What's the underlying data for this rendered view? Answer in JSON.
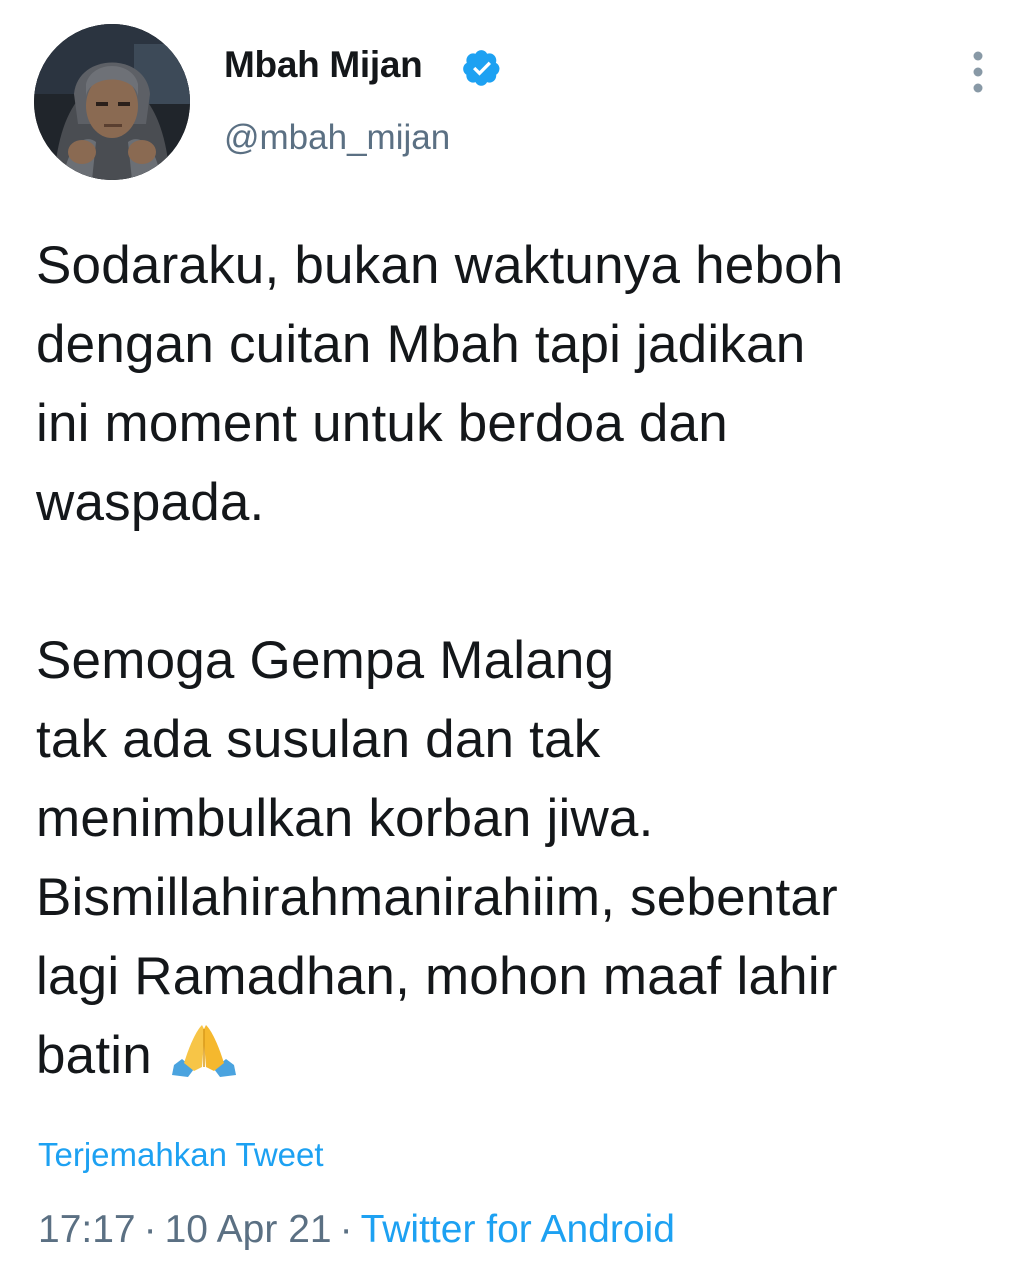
{
  "user": {
    "display_name": "Mbah Mijan",
    "handle": "@mbah_mijan",
    "verified": true
  },
  "tweet": {
    "text": "Sodaraku, bukan waktunya heboh\ndengan cuitan Mbah tapi jadikan\nini moment untuk berdoa dan\nwaspada.\n\nSemoga Gempa Malang\ntak ada susulan dan tak\nmenimbulkan korban jiwa.\nBismillahirahmanirahiim, sebentar\nlagi Ramadhan, mohon maaf lahir\nbatin",
    "emoji": "folded-hands"
  },
  "translate_label": "Terjemahkan Tweet",
  "meta": {
    "time": "17:17",
    "date": "10 Apr 21",
    "separator": "·",
    "source": "Twitter for Android"
  },
  "colors": {
    "text": "#14171a",
    "secondary": "#5b7083",
    "accent": "#1da1f2"
  }
}
